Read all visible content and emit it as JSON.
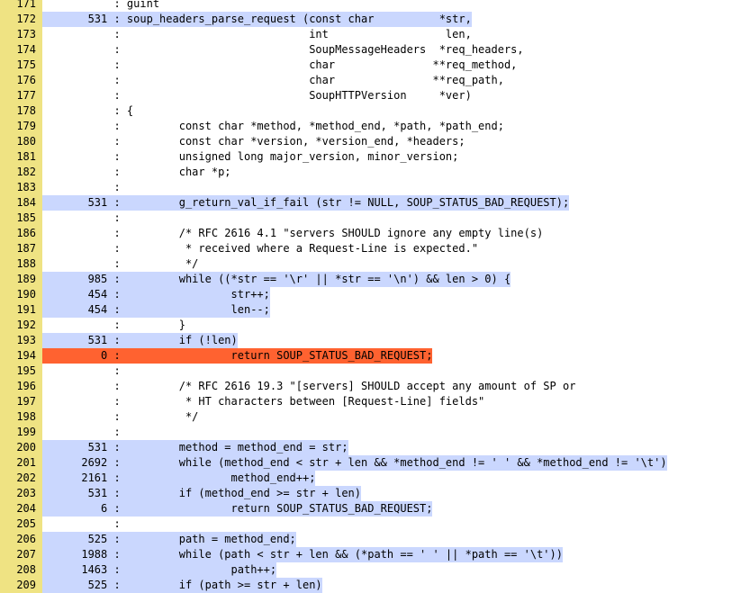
{
  "colors": {
    "line_number_bg": "#efe383",
    "covered_bg": "#cad7fe",
    "uncovered_bg": "#ff6230",
    "plain_bg": "#ffffff"
  },
  "lines": [
    {
      "num": "171",
      "count": "",
      "code": "guint",
      "status": "plain"
    },
    {
      "num": "172",
      "count": "531",
      "code": "soup_headers_parse_request (const char          *str,",
      "status": "hit"
    },
    {
      "num": "173",
      "count": "",
      "code": "                            int                  len,",
      "status": "plain"
    },
    {
      "num": "174",
      "count": "",
      "code": "                            SoupMessageHeaders  *req_headers,",
      "status": "plain"
    },
    {
      "num": "175",
      "count": "",
      "code": "                            char               **req_method,",
      "status": "plain"
    },
    {
      "num": "176",
      "count": "",
      "code": "                            char               **req_path,",
      "status": "plain"
    },
    {
      "num": "177",
      "count": "",
      "code": "                            SoupHTTPVersion     *ver)",
      "status": "plain"
    },
    {
      "num": "178",
      "count": "",
      "code": "{",
      "status": "plain"
    },
    {
      "num": "179",
      "count": "",
      "code": "        const char *method, *method_end, *path, *path_end;",
      "status": "plain"
    },
    {
      "num": "180",
      "count": "",
      "code": "        const char *version, *version_end, *headers;",
      "status": "plain"
    },
    {
      "num": "181",
      "count": "",
      "code": "        unsigned long major_version, minor_version;",
      "status": "plain"
    },
    {
      "num": "182",
      "count": "",
      "code": "        char *p;",
      "status": "plain"
    },
    {
      "num": "183",
      "count": "",
      "code": "",
      "status": "plain"
    },
    {
      "num": "184",
      "count": "531",
      "code": "        g_return_val_if_fail (str != NULL, SOUP_STATUS_BAD_REQUEST);",
      "status": "hit"
    },
    {
      "num": "185",
      "count": "",
      "code": "",
      "status": "plain"
    },
    {
      "num": "186",
      "count": "",
      "code": "        /* RFC 2616 4.1 \"servers SHOULD ignore any empty line(s)",
      "status": "plain"
    },
    {
      "num": "187",
      "count": "",
      "code": "         * received where a Request-Line is expected.\"",
      "status": "plain"
    },
    {
      "num": "188",
      "count": "",
      "code": "         */",
      "status": "plain"
    },
    {
      "num": "189",
      "count": "985",
      "code": "        while ((*str == '\\r' || *str == '\\n') && len > 0) {",
      "status": "hit"
    },
    {
      "num": "190",
      "count": "454",
      "code": "                str++;",
      "status": "hit"
    },
    {
      "num": "191",
      "count": "454",
      "code": "                len--;",
      "status": "hit"
    },
    {
      "num": "192",
      "count": "",
      "code": "        }",
      "status": "plain"
    },
    {
      "num": "193",
      "count": "531",
      "code": "        if (!len)",
      "status": "hit"
    },
    {
      "num": "194",
      "count": "0",
      "code": "                return SOUP_STATUS_BAD_REQUEST;",
      "status": "miss"
    },
    {
      "num": "195",
      "count": "",
      "code": "",
      "status": "plain"
    },
    {
      "num": "196",
      "count": "",
      "code": "        /* RFC 2616 19.3 \"[servers] SHOULD accept any amount of SP or",
      "status": "plain"
    },
    {
      "num": "197",
      "count": "",
      "code": "         * HT characters between [Request-Line] fields\"",
      "status": "plain"
    },
    {
      "num": "198",
      "count": "",
      "code": "         */",
      "status": "plain"
    },
    {
      "num": "199",
      "count": "",
      "code": "",
      "status": "plain"
    },
    {
      "num": "200",
      "count": "531",
      "code": "        method = method_end = str;",
      "status": "hit"
    },
    {
      "num": "201",
      "count": "2692",
      "code": "        while (method_end < str + len && *method_end != ' ' && *method_end != '\\t')",
      "status": "hit"
    },
    {
      "num": "202",
      "count": "2161",
      "code": "                method_end++;",
      "status": "hit"
    },
    {
      "num": "203",
      "count": "531",
      "code": "        if (method_end >= str + len)",
      "status": "hit"
    },
    {
      "num": "204",
      "count": "6",
      "code": "                return SOUP_STATUS_BAD_REQUEST;",
      "status": "hit"
    },
    {
      "num": "205",
      "count": "",
      "code": "",
      "status": "plain"
    },
    {
      "num": "206",
      "count": "525",
      "code": "        path = method_end;",
      "status": "hit"
    },
    {
      "num": "207",
      "count": "1988",
      "code": "        while (path < str + len && (*path == ' ' || *path == '\\t'))",
      "status": "hit"
    },
    {
      "num": "208",
      "count": "1463",
      "code": "                path++;",
      "status": "hit"
    },
    {
      "num": "209",
      "count": "525",
      "code": "        if (path >= str + len)",
      "status": "hit"
    }
  ]
}
